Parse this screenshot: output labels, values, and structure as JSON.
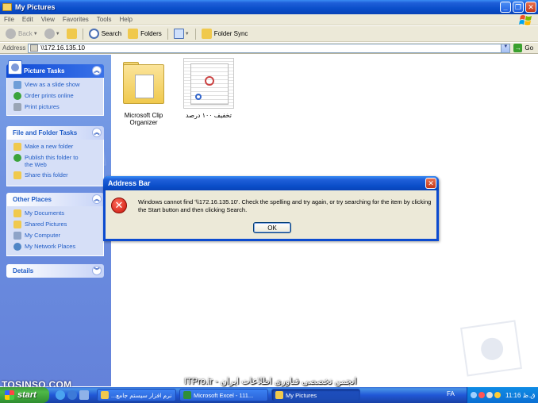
{
  "window": {
    "title": "My Pictures"
  },
  "menu": [
    "File",
    "Edit",
    "View",
    "Favorites",
    "Tools",
    "Help"
  ],
  "toolbar": {
    "back": "Back",
    "search": "Search",
    "folders": "Folders",
    "folder_sync": "Folder Sync"
  },
  "address": {
    "label": "Address",
    "value": "\\\\172.16.135.10",
    "go": "Go"
  },
  "taskpane": {
    "picture_tasks": {
      "title": "Picture Tasks",
      "items": [
        "View as a slide show",
        "Order prints online",
        "Print pictures"
      ]
    },
    "file_folder_tasks": {
      "title": "File and Folder Tasks",
      "items": [
        "Make a new folder",
        "Publish this folder to the Web",
        "Share this folder"
      ]
    },
    "other_places": {
      "title": "Other Places",
      "items": [
        "My Documents",
        "Shared Pictures",
        "My Computer",
        "My Network Places"
      ]
    },
    "details": {
      "title": "Details"
    }
  },
  "files": [
    {
      "name": "Microsoft Clip Organizer"
    },
    {
      "name": "تخفیف ۱۰۰ درصد"
    }
  ],
  "dialog": {
    "title": "Address Bar",
    "message": "Windows cannot find '\\\\172.16.135.10'.  Check the spelling and try again, or try searching for the item by clicking the Start button and then clicking Search.",
    "ok": "OK"
  },
  "overlay": {
    "left": "TOSINSO.COM",
    "right": "ITPro.ir - انجمن تخصصی فناوری اطلاعات ایران"
  },
  "taskbar": {
    "start": "start",
    "buttons": [
      "نرم افزار سیستم جامع...",
      "Microsoft Excel - 111...",
      "My Pictures"
    ],
    "language": "FA",
    "clock": "11:16 ق.ظ"
  },
  "colors": {
    "xp_blue": "#0a4ec9",
    "task_pane": "#6c8fe0",
    "start_green": "#3c9a3c"
  }
}
